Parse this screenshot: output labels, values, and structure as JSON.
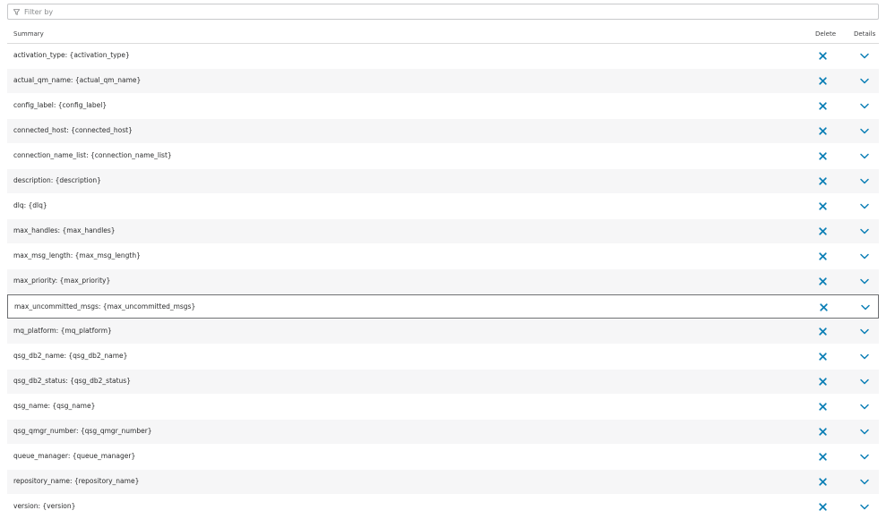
{
  "filter": {
    "placeholder": "Filter by",
    "value": ""
  },
  "header": {
    "summary": "Summary",
    "delete": "Delete",
    "details": "Details"
  },
  "colors": {
    "accent": "#0b7fb6",
    "selected_border": "#6c6d70",
    "row_alt": "#f6f6f7"
  },
  "rows": [
    {
      "label": "activation_type: {activation_type}"
    },
    {
      "label": "actual_qm_name: {actual_qm_name}"
    },
    {
      "label": "config_label: {config_label}"
    },
    {
      "label": "connected_host: {connected_host}"
    },
    {
      "label": "connection_name_list: {connection_name_list}"
    },
    {
      "label": "description: {description}"
    },
    {
      "label": "dlq: {dlq}"
    },
    {
      "label": "max_handles: {max_handles}"
    },
    {
      "label": "max_msg_length: {max_msg_length}"
    },
    {
      "label": "max_priority: {max_priority}"
    },
    {
      "label": "max_uncommitted_msgs: {max_uncommitted_msgs}",
      "selected": true
    },
    {
      "label": "mq_platform: {mq_platform}"
    },
    {
      "label": "qsg_db2_name: {qsg_db2_name}"
    },
    {
      "label": "qsg_db2_status: {qsg_db2_status}"
    },
    {
      "label": "qsg_name: {qsg_name}"
    },
    {
      "label": "qsg_qmgr_number: {qsg_qmgr_number}"
    },
    {
      "label": "queue_manager: {queue_manager}"
    },
    {
      "label": "repository_name: {repository_name}"
    },
    {
      "label": "version: {version}"
    }
  ]
}
